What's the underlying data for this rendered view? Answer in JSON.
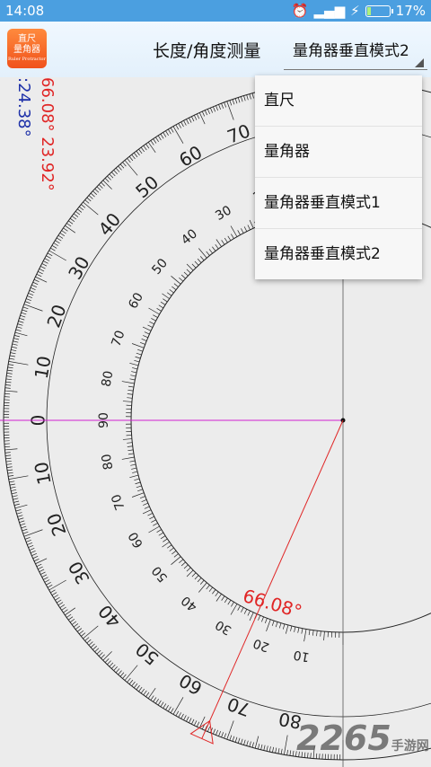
{
  "status": {
    "time": "14:08",
    "battery": "17%",
    "battery_level": 0.17
  },
  "app": {
    "logo_text_line1": "直尺",
    "logo_text_line2": "量角器",
    "logo_sub": "Ruler Protractor",
    "title": "长度/角度测量"
  },
  "mode_select": {
    "value": "量角器垂直模式2"
  },
  "readouts": {
    "red": "66.08° 23.92°",
    "blue": ":24.38°"
  },
  "protractor": {
    "measured_angle_label": "66.08°",
    "measured_angle": 66.08,
    "outer_scale_labels": [
      "80",
      "70",
      "60",
      "50",
      "40",
      "30",
      "20",
      "10",
      "0",
      "10",
      "20",
      "30",
      "40",
      "50",
      "60",
      "70",
      "80"
    ],
    "inner_scale_labels": [
      "10",
      "20",
      "30",
      "40",
      "50",
      "60",
      "70",
      "80",
      "90",
      "80",
      "70",
      "60",
      "50",
      "40",
      "30",
      "20",
      "10"
    ],
    "colors": {
      "red": "#e02525",
      "magenta": "#d020d0",
      "ink": "#222222"
    }
  },
  "menu": {
    "items": [
      "直尺",
      "量角器",
      "量角器垂直模式1",
      "量角器垂直模式2"
    ]
  },
  "watermark": {
    "text": "2265",
    "suffix": "手游网"
  }
}
